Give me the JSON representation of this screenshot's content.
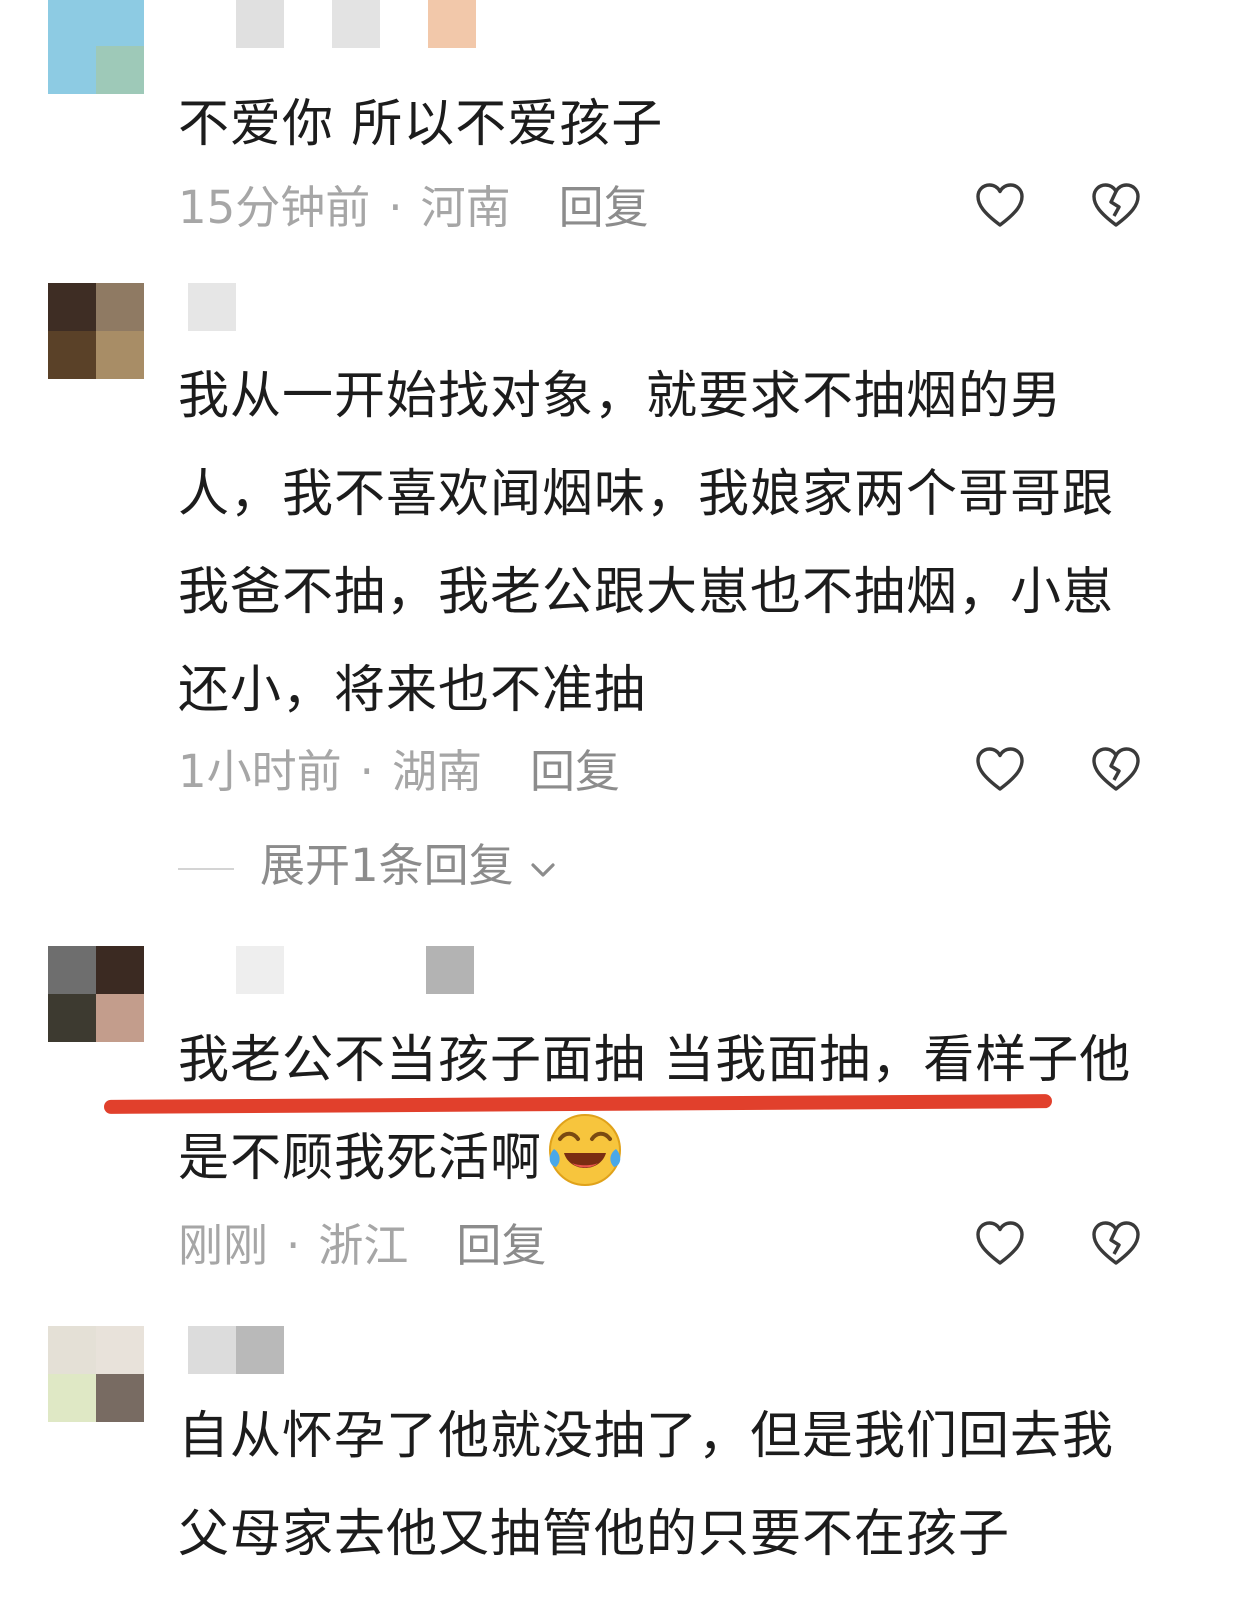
{
  "colors": {
    "meta_text": "#a6a6a6",
    "reply_text": "#8c8c8c",
    "icon_stroke": "#3a3a3a",
    "highlight_underline": "#e1402c"
  },
  "icons": {
    "like": "heart-outline-icon",
    "dislike": "broken-heart-icon",
    "expand": "chevron-down-icon",
    "emoji": "laughing-crying-emoji-icon"
  },
  "comments": [
    {
      "text": "不爱你  所以不爱孩子",
      "time": "15分钟前",
      "separator": "·",
      "location": "河南",
      "reply_label": "回复"
    },
    {
      "text": "我从一开始找对象，就要求不抽烟的男人，我不喜欢闻烟味，我娘家两个哥哥跟我爸不抽，我老公跟大崽也不抽烟，小崽还小，将来也不准抽",
      "time": "1小时前",
      "separator": "·",
      "location": "湖南",
      "reply_label": "回复",
      "expand_label": "展开1条回复"
    },
    {
      "text": "我老公不当孩子面抽  当我面抽，看样子他是不顾我死活啊",
      "time": "刚刚",
      "separator": "·",
      "location": "浙江",
      "reply_label": "回复"
    },
    {
      "text": "自从怀孕了他就没抽了，但是我们回去我父母家去他又抽管他的只要不在孩子"
    }
  ]
}
